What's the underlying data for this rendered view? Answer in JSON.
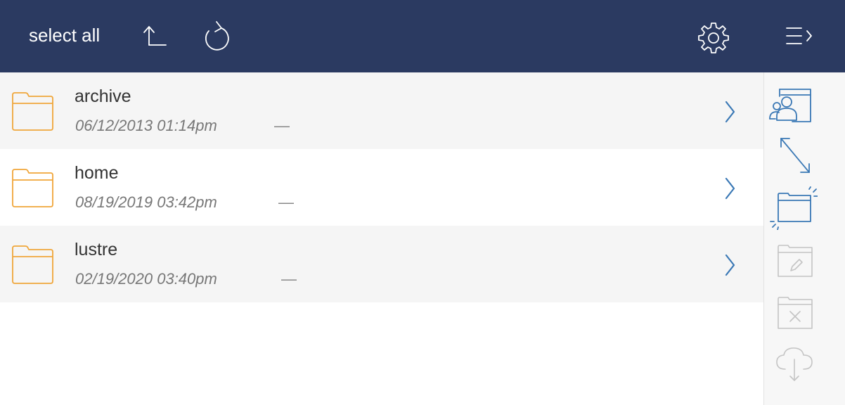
{
  "toolbar": {
    "select_all_label": "select all",
    "icons": [
      "up-arrow-icon",
      "refresh-icon",
      "gear-icon",
      "menu-collapse-icon"
    ],
    "background_color": "#2b3a61"
  },
  "files": {
    "items": [
      {
        "name": "archive",
        "date": "06/12/2013 01:14pm",
        "size": "—",
        "type": "folder"
      },
      {
        "name": "home",
        "date": "08/19/2019 03:42pm",
        "size": "—",
        "type": "folder"
      },
      {
        "name": "lustre",
        "date": "02/19/2020 03:40pm",
        "size": "—",
        "type": "folder"
      }
    ],
    "folder_color": "#f0a63a",
    "chevron_color": "#3a78b5"
  },
  "sidebar": {
    "actions": [
      {
        "icon": "shared-folder-icon",
        "enabled": true
      },
      {
        "icon": "transfer-arrows-icon",
        "enabled": true
      },
      {
        "icon": "new-folder-icon",
        "enabled": true
      },
      {
        "icon": "rename-folder-icon",
        "enabled": false
      },
      {
        "icon": "delete-folder-icon",
        "enabled": false
      },
      {
        "icon": "cloud-download-icon",
        "enabled": false
      }
    ],
    "active_color": "#3a78b5",
    "disabled_color": "#c4c4c4"
  }
}
